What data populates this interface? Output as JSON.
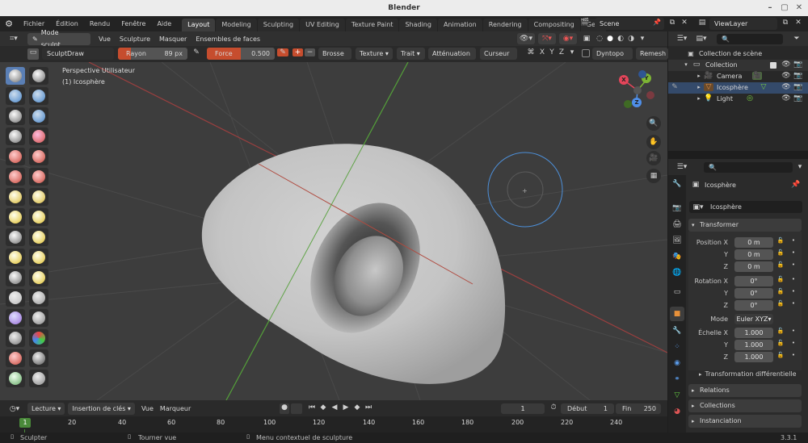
{
  "window": {
    "title": "Blender"
  },
  "topbar": {
    "menus": [
      "Fichier",
      "Édition",
      "Rendu",
      "Fenêtre",
      "Aide"
    ],
    "workspaces": [
      "Layout",
      "Modeling",
      "Sculpting",
      "UV Editing",
      "Texture Paint",
      "Shading",
      "Animation",
      "Rendering",
      "Compositing",
      "Geome"
    ],
    "active_workspace": "Layout",
    "scene": "Scene",
    "viewlayer": "ViewLayer"
  },
  "header": {
    "mode": "Mode sculpt...",
    "menus": [
      "Vue",
      "Sculpture",
      "Masquer",
      "Ensembles de faces"
    ]
  },
  "toolsettings": {
    "brush": "SculptDraw",
    "radius_label": "Rayon",
    "radius_value": "89 px",
    "strength_label": "Force",
    "strength_value": "0.500",
    "plus": "+",
    "minus": "−",
    "dropdowns": [
      "Brosse",
      "Texture",
      "Trait",
      "Atténuation",
      "Curseur"
    ],
    "axes": [
      "X",
      "Y",
      "Z"
    ],
    "dyntopo": "Dyntopo",
    "remesh": "Remesh"
  },
  "viewport": {
    "view_name": "Perspective Utilisateur",
    "object_name": "(1) Icosphère",
    "gizmo": {
      "x": "X",
      "y": "Y",
      "z": "Z"
    },
    "colors": {
      "x": "#e4455a",
      "y": "#7db534",
      "z": "#4f8fe8"
    }
  },
  "outliner": {
    "root": "Collection de scène",
    "collection": "Collection",
    "items": [
      "Camera",
      "Icosphère",
      "Light"
    ]
  },
  "properties": {
    "object_name": "Icosphère",
    "datablock": "Icosphère",
    "transform_title": "Transformer",
    "position_label": "Position X",
    "position": [
      "0 m",
      "0 m",
      "0 m"
    ],
    "rotation_label": "Rotation X",
    "rotation": [
      "0°",
      "0°",
      "0°"
    ],
    "mode_label": "Mode",
    "mode_value": "Euler XYZ",
    "scale_label": "Échelle X",
    "scale": [
      "1.000",
      "1.000",
      "1.000"
    ],
    "axis_y": "Y",
    "axis_z": "Z",
    "delta": "Transformation différentielle",
    "relations": "Relations",
    "collections": "Collections",
    "instancing": "Instanciation"
  },
  "timeline": {
    "menus": [
      "Lecture",
      "Insertion de clés",
      "Vue",
      "Marqueur"
    ],
    "current_frame": "1",
    "start_label": "Début",
    "start": "1",
    "end_label": "Fin",
    "end": "250",
    "ticks": [
      "1",
      "20",
      "40",
      "60",
      "80",
      "100",
      "120",
      "140",
      "160",
      "180",
      "200",
      "220",
      "240"
    ]
  },
  "statusbar": {
    "left": "Sculpter",
    "mid": "Tourner vue",
    "right": "Menu contextuel de sculpture",
    "version": "3.3.1"
  }
}
